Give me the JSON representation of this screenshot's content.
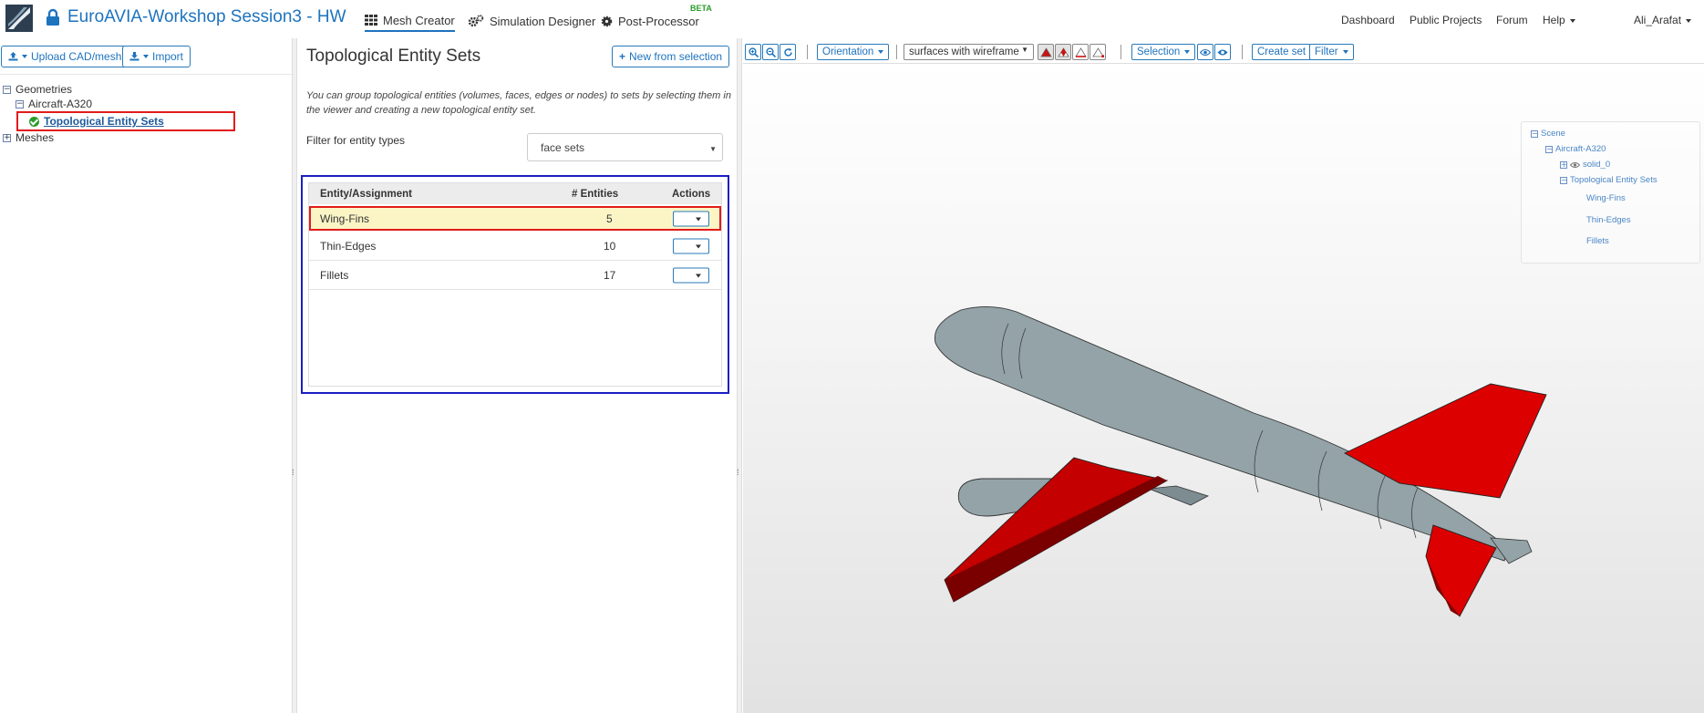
{
  "navbar": {
    "project_title": "EuroAVIA-Workshop Session3 - HW",
    "tabs": [
      {
        "label": "Mesh Creator",
        "icon": "grid-icon",
        "active": true
      },
      {
        "label": "Simulation Designer",
        "icon": "gears-icon",
        "active": false
      },
      {
        "label": "Post-Processor",
        "icon": "gear-icon",
        "active": false,
        "badge": "BETA"
      }
    ],
    "right_links": [
      "Dashboard",
      "Public Projects",
      "Forum",
      "Help"
    ],
    "user": "Ali_Arafat",
    "accent_color": "#1e73be"
  },
  "left_panel": {
    "upload_button": "Upload CAD/mesh",
    "import_button": "Import",
    "tree": {
      "geometries": "Geometries",
      "aircraft": "Aircraft-A320",
      "entity_sets": "Topological Entity Sets",
      "meshes": "Meshes"
    }
  },
  "middle_panel": {
    "title": "Topological Entity Sets",
    "new_button": "New from selection",
    "description": "You can group topological entities (volumes, faces, edges or nodes) to sets by selecting them in the viewer and creating a new topological entity set.",
    "filter_label": "Filter for entity types",
    "filter_value": "face sets",
    "table": {
      "headers": [
        "Entity/Assignment",
        "# Entities",
        "Actions"
      ],
      "rows": [
        {
          "name": "Wing-Fins",
          "count": "5",
          "selected": true
        },
        {
          "name": "Thin-Edges",
          "count": "10",
          "selected": false
        },
        {
          "name": "Fillets",
          "count": "17",
          "selected": false
        }
      ]
    }
  },
  "viewer": {
    "toolbar": {
      "orientation": "Orientation",
      "render_mode": "surfaces with wireframe",
      "selection": "Selection",
      "create_set": "Create set",
      "filter": "Filter"
    },
    "scene_tree": {
      "root": "Scene",
      "aircraft": "Aircraft-A320",
      "solid": "solid_0",
      "entity_sets": "Topological Entity Sets",
      "sets": [
        "Wing-Fins",
        "Thin-Edges",
        "Fillets"
      ]
    },
    "colors": {
      "fuselage": "#93a3a8",
      "selected_faces": "#dd0000"
    }
  }
}
